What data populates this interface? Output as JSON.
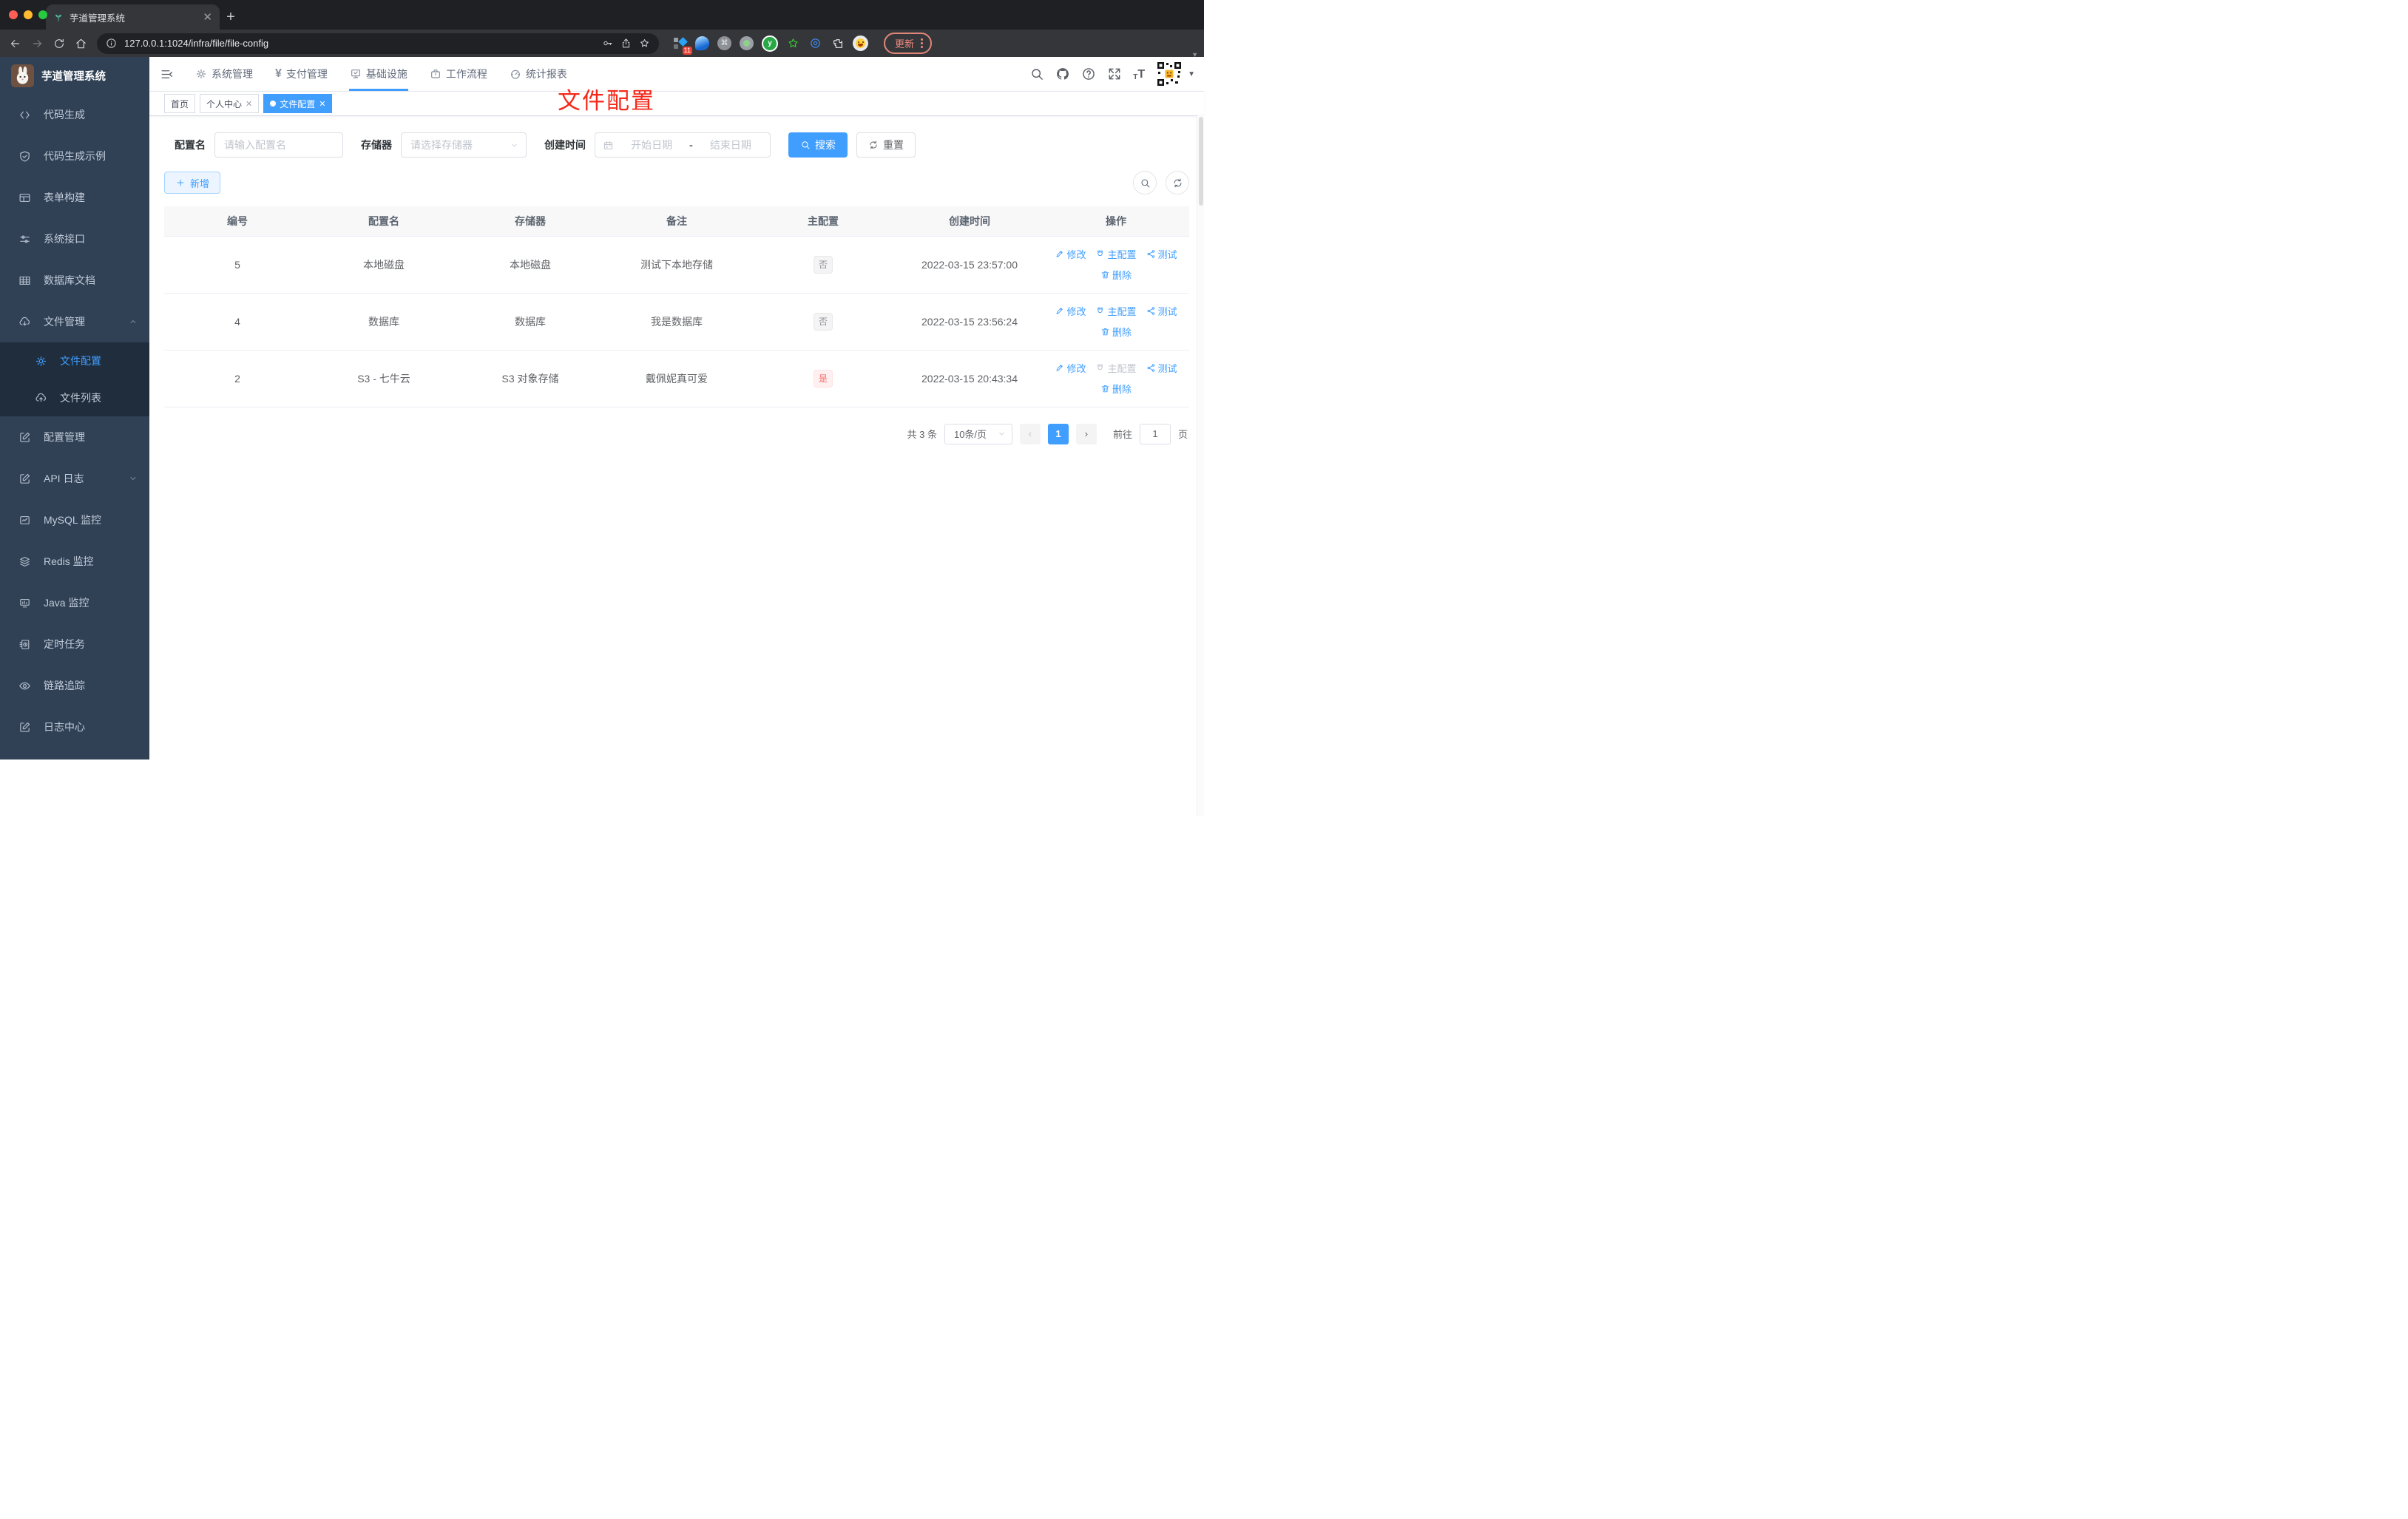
{
  "browser": {
    "tab_title": "芋道管理系统",
    "url": "127.0.0.1:1024/infra/file/file-config",
    "update_label": "更新",
    "extension_badge": "11"
  },
  "sidebar": {
    "logo_title": "芋道管理系统",
    "items": [
      {
        "label": "代码生成"
      },
      {
        "label": "代码生成示例"
      },
      {
        "label": "表单构建"
      },
      {
        "label": "系统接口"
      },
      {
        "label": "数据库文档"
      },
      {
        "label": "文件管理"
      },
      {
        "label": "文件配置"
      },
      {
        "label": "文件列表"
      },
      {
        "label": "配置管理"
      },
      {
        "label": "API 日志"
      },
      {
        "label": "MySQL 监控"
      },
      {
        "label": "Redis 监控"
      },
      {
        "label": "Java 监控"
      },
      {
        "label": "定时任务"
      },
      {
        "label": "链路追踪"
      },
      {
        "label": "日志中心"
      }
    ]
  },
  "topnav": {
    "items": [
      {
        "label": "系统管理"
      },
      {
        "label": "支付管理"
      },
      {
        "label": "基础设施"
      },
      {
        "label": "工作流程"
      },
      {
        "label": "统计报表"
      }
    ]
  },
  "tabs": [
    {
      "label": "首页"
    },
    {
      "label": "个人中心"
    },
    {
      "label": "文件配置"
    }
  ],
  "annotation": {
    "text": "文件配置",
    "color": "#f5291b"
  },
  "filters": {
    "name_label": "配置名",
    "name_placeholder": "请输入配置名",
    "storage_label": "存储器",
    "storage_placeholder": "请选择存储器",
    "date_label": "创建时间",
    "date_start_placeholder": "开始日期",
    "date_separator": "-",
    "date_end_placeholder": "结束日期",
    "search_label": "搜索",
    "reset_label": "重置"
  },
  "toolbar": {
    "add_label": "新增"
  },
  "table": {
    "columns": [
      "编号",
      "配置名",
      "存储器",
      "备注",
      "主配置",
      "创建时间",
      "操作"
    ],
    "action_labels": {
      "edit": "修改",
      "master": "主配置",
      "test": "测试",
      "delete": "删除"
    },
    "rows": [
      {
        "id": "5",
        "name": "本地磁盘",
        "storage": "本地磁盘",
        "remark": "测试下本地存储",
        "master": "否",
        "created": "2022-03-15 23:57:00"
      },
      {
        "id": "4",
        "name": "数据库",
        "storage": "数据库",
        "remark": "我是数据库",
        "master": "否",
        "created": "2022-03-15 23:56:24"
      },
      {
        "id": "2",
        "name": "S3 - 七牛云",
        "storage": "S3 对象存储",
        "remark": "戴佩妮真可爱",
        "master": "是",
        "created": "2022-03-15 20:43:34"
      }
    ]
  },
  "pagination": {
    "total": "共 3 条",
    "page_size": "10条/页",
    "current_page": "1",
    "goto_label": "前往",
    "goto_value": "1",
    "page_unit": "页"
  },
  "colors": {
    "primary": "#409eff",
    "annotation_red": "#f5291b",
    "sidebar_bg": "#304156",
    "submenu_bg": "#1f2d3d"
  }
}
